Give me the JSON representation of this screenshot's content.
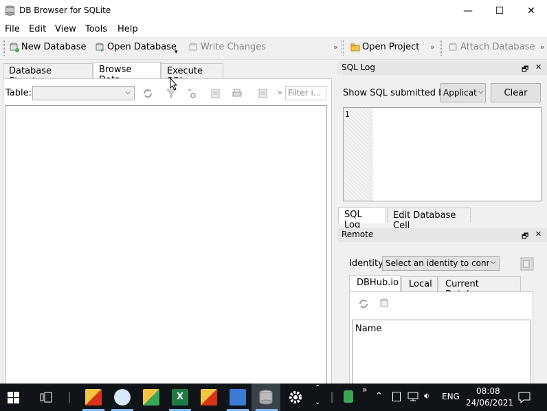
{
  "window": {
    "title": "DB Browser for SQLite",
    "minimize": "—",
    "maximize": "☐",
    "close": "✕"
  },
  "menu": [
    "File",
    "Edit",
    "View",
    "Tools",
    "Help"
  ],
  "toolbar": {
    "new_db": "New Database",
    "open_db": "Open Database",
    "write_changes": "Write Changes",
    "open_project": "Open Project",
    "attach_db": "Attach Database"
  },
  "tabs": [
    "Database Structure",
    "Browse Data",
    "Execute SQL"
  ],
  "browse": {
    "table_label": "Table:",
    "filter_placeholder": "Filter i..."
  },
  "sql_log": {
    "title": "SQL Log",
    "show_label": "Show SQL submitted by",
    "submitter": "Applicat",
    "clear": "Clear",
    "line_number": "1"
  },
  "right_tabs": [
    "SQL Log",
    "Edit Database Cell"
  ],
  "remote": {
    "title": "Remote",
    "identity_label": "Identity",
    "identity_value": "Select an identity to conne",
    "tabs": [
      "DBHub.io",
      "Local",
      "Current Database"
    ],
    "column_name": "Name"
  },
  "taskbar": {
    "language": "ENG",
    "time": "08:08",
    "date": "24/06/2021"
  }
}
